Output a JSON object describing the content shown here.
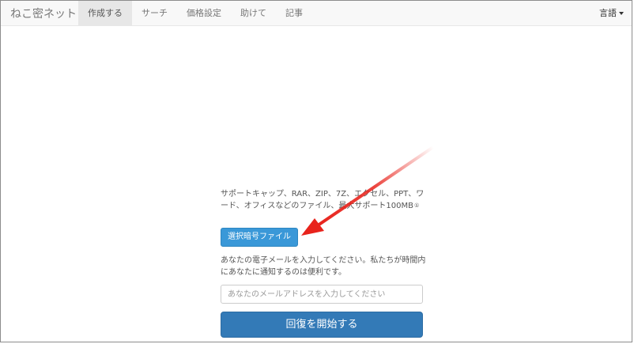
{
  "navbar": {
    "brand": "ねこ密ネット",
    "items": [
      {
        "label": "作成する",
        "active": true
      },
      {
        "label": "サーチ",
        "active": false
      },
      {
        "label": "価格設定",
        "active": false
      },
      {
        "label": "助けて",
        "active": false
      },
      {
        "label": "記事",
        "active": false
      }
    ],
    "language": "言語"
  },
  "upload": {
    "support_text": "サポートキャップ、RAR、ZIP、7Z、エクセル、PPT、ワード、オフィスなどのファイル、最大サポート100MB",
    "info_mark": "①",
    "select_button": "選択暗号ファイル"
  },
  "email": {
    "note": "あなたの電子メールを入力してください。私たちが時間内にあなたに通知するのは便利です。",
    "placeholder": "あなたのメールアドレスを入力してください"
  },
  "start_button": "回復を開始する",
  "annotation": {
    "arrow_color": "#e8231c"
  }
}
